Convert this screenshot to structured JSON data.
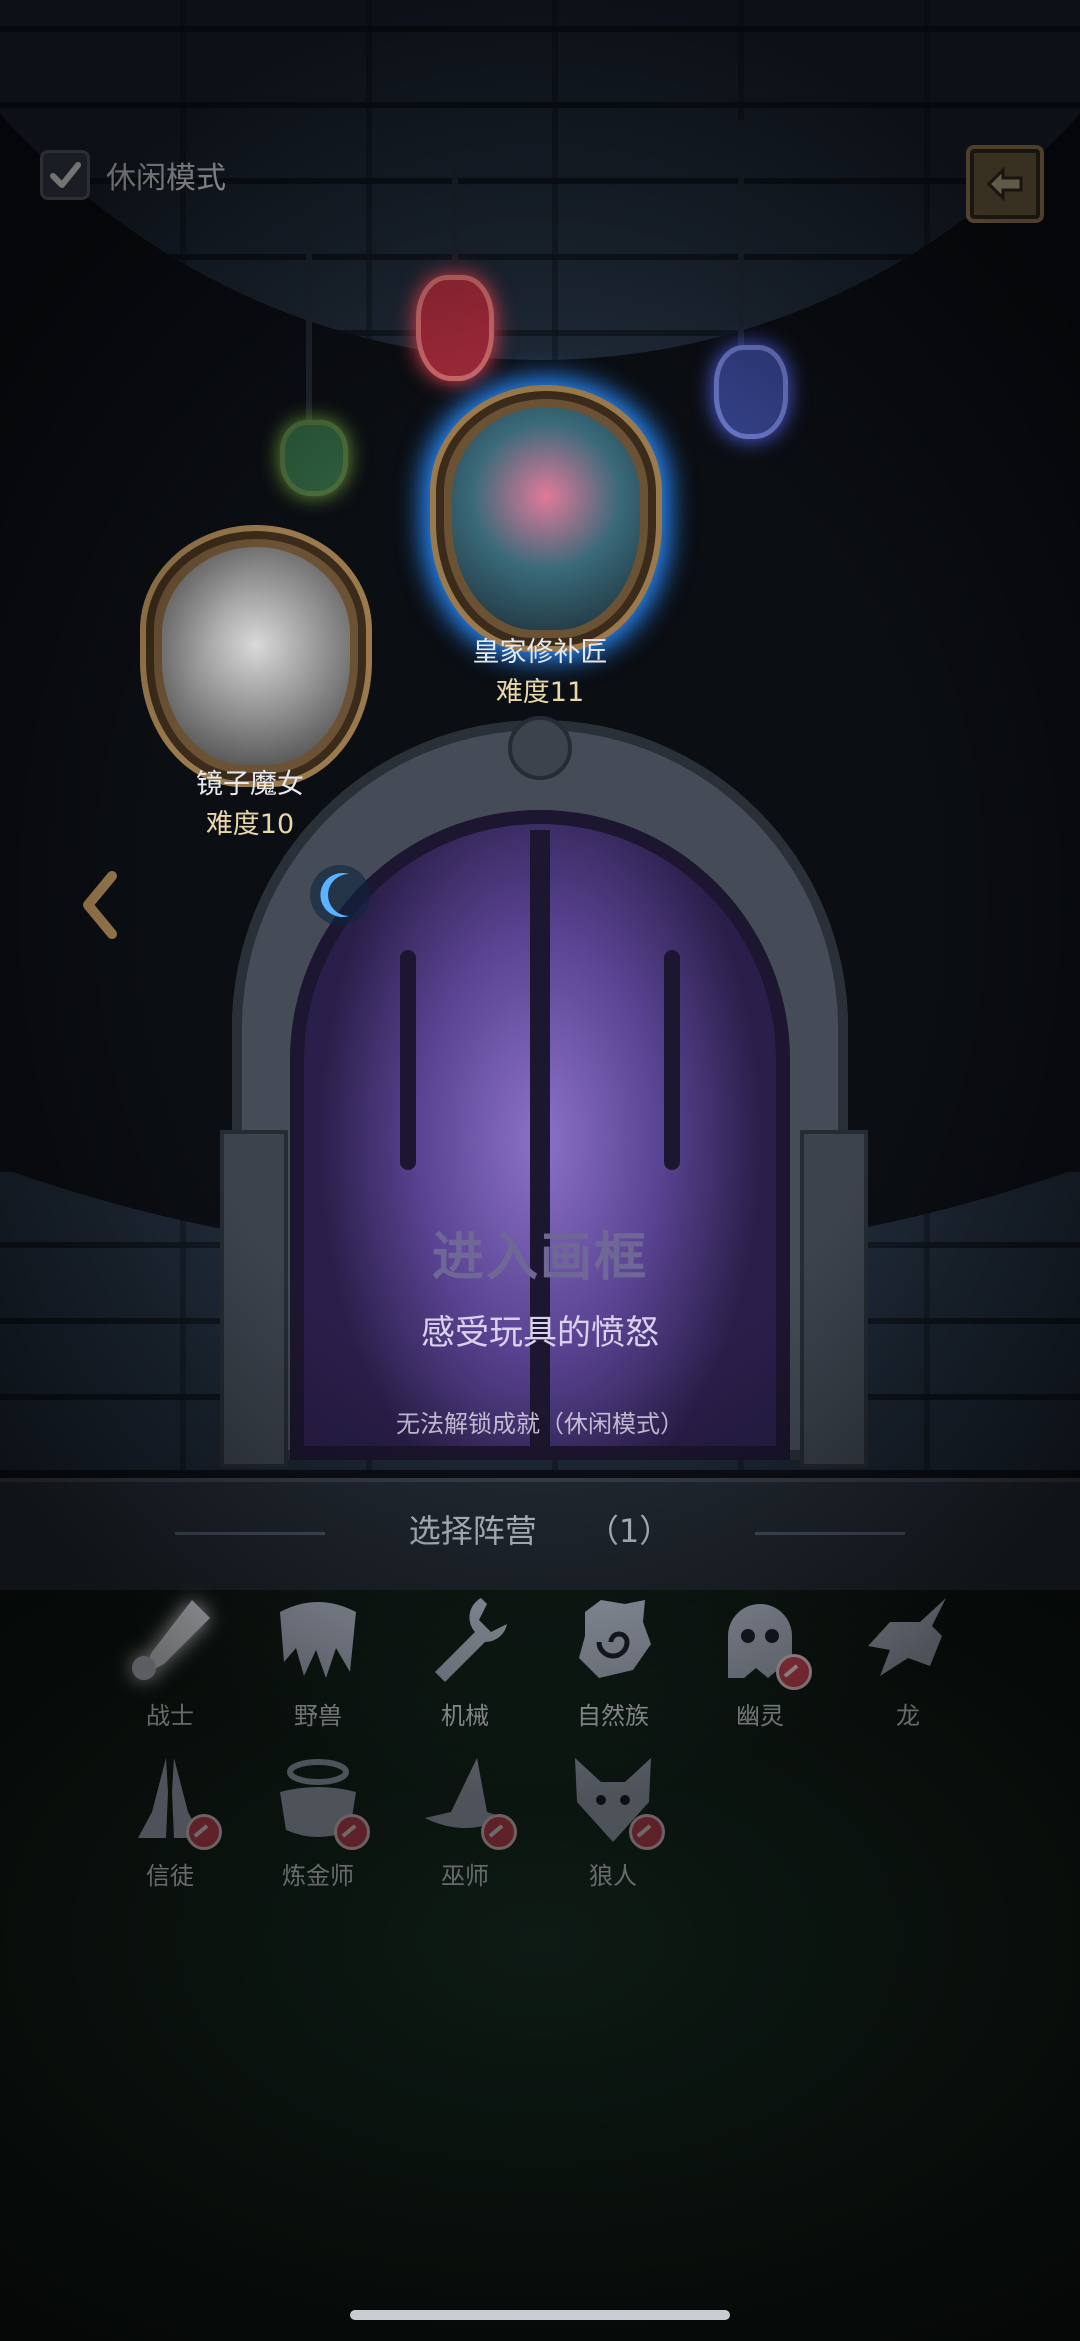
{
  "mode": {
    "label": "休闲模式",
    "checked": true
  },
  "back_button": {
    "icon": "back-arrow-icon"
  },
  "portraits": [
    {
      "name": "镜子魔女",
      "difficulty": "难度10"
    },
    {
      "name": "皇家修补匠",
      "difficulty": "难度11"
    }
  ],
  "door": {
    "title": "进入画框",
    "subtitle": "感受玩具的愤怒",
    "note": "无法解锁成就（休闲模式）"
  },
  "faction_header": {
    "title": "选择阵营",
    "count": "（1）"
  },
  "factions": [
    {
      "label": "战士",
      "icon": "sword-icon",
      "selected": true,
      "locked": false
    },
    {
      "label": "野兽",
      "icon": "claw-icon",
      "selected": false,
      "locked": false
    },
    {
      "label": "机械",
      "icon": "wrench-icon",
      "selected": false,
      "locked": false
    },
    {
      "label": "自然族",
      "icon": "spiral-beast-icon",
      "selected": false,
      "locked": false
    },
    {
      "label": "幽灵",
      "icon": "ghost-icon",
      "selected": false,
      "locked": true
    },
    {
      "label": "龙",
      "icon": "dragon-icon",
      "selected": false,
      "locked": false
    },
    {
      "label": "信徒",
      "icon": "praying-hands-icon",
      "selected": false,
      "locked": true
    },
    {
      "label": "炼金师",
      "icon": "cauldron-icon",
      "selected": false,
      "locked": true
    },
    {
      "label": "巫师",
      "icon": "wizard-hat-icon",
      "selected": false,
      "locked": true
    },
    {
      "label": "狼人",
      "icon": "wolf-icon",
      "selected": false,
      "locked": true
    }
  ],
  "colors": {
    "accent_blue": "#4aa8ff",
    "difficulty_gold": "#e8d7a8",
    "locked_red": "#d34a5a"
  }
}
